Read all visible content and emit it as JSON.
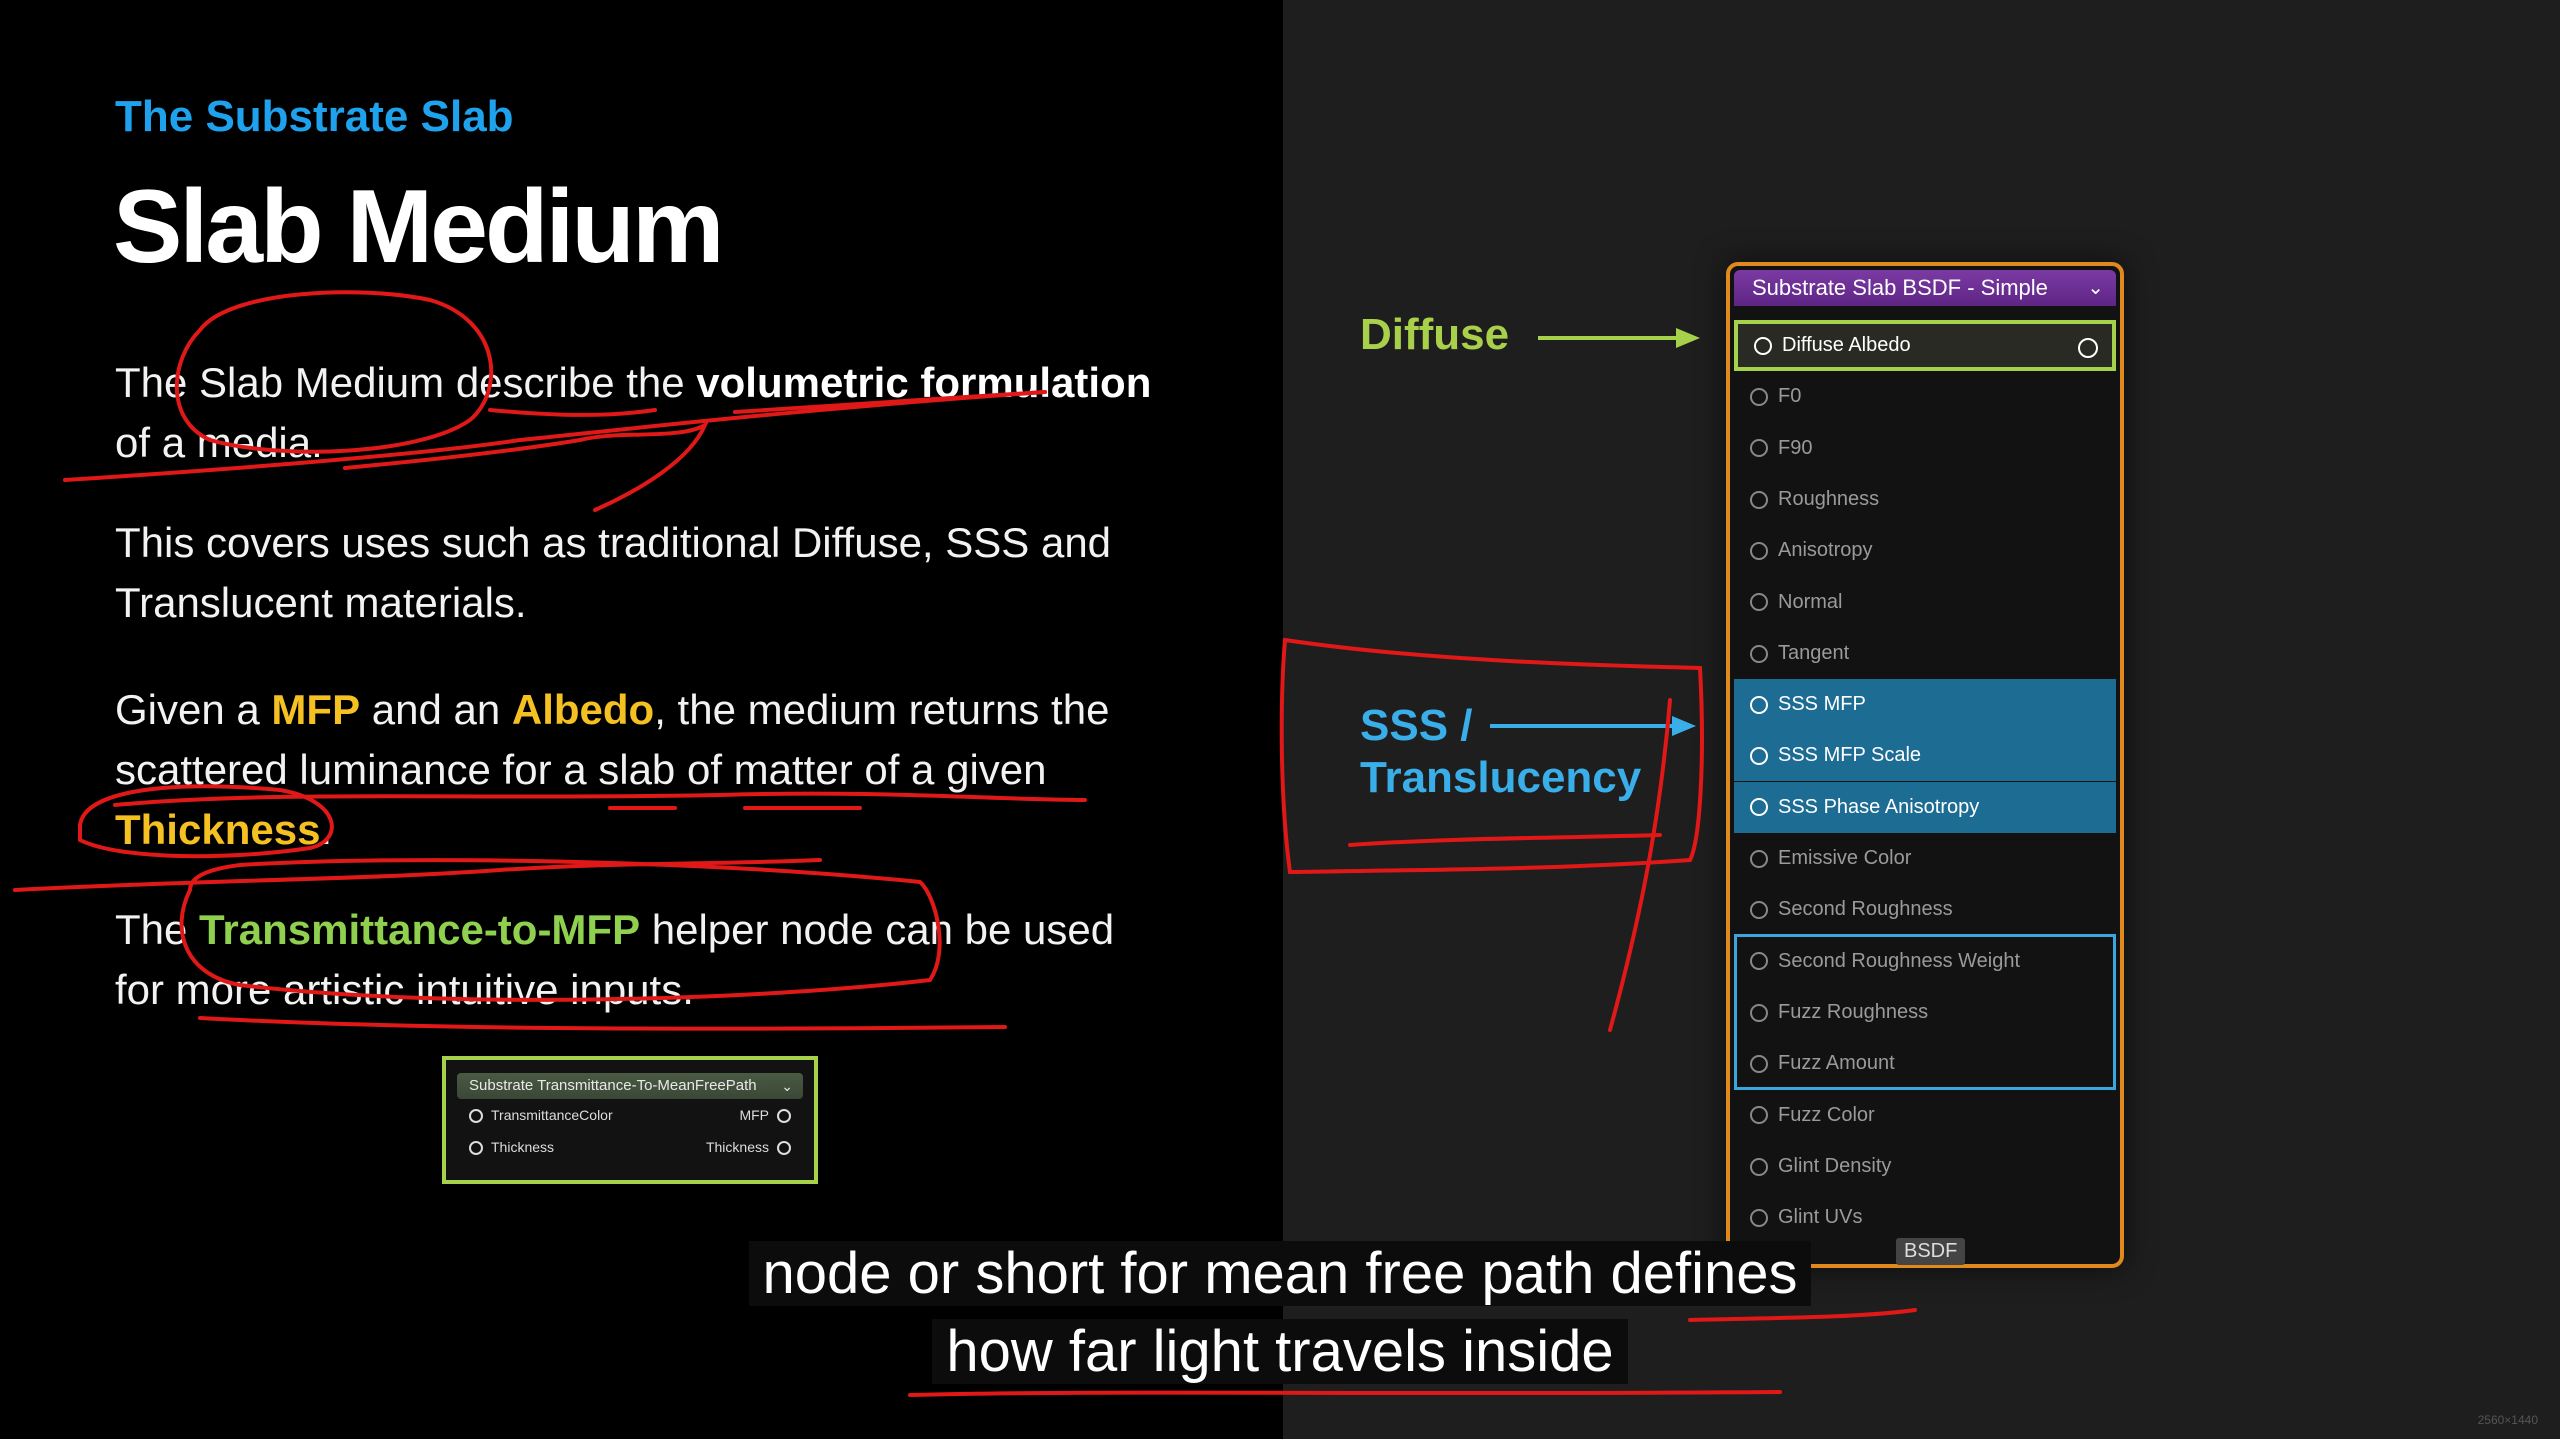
{
  "slide": {
    "eyebrow": "The Substrate Slab",
    "title": "Slab Medium",
    "p1": {
      "t1": "The Slab Medium describe the ",
      "b1": "volumetric formulation",
      "t2": " of a media."
    },
    "p2": "This covers uses such as traditional Diffuse, SSS and Translucent materials.",
    "p3": {
      "t1": "Given a ",
      "mfp": "MFP",
      "t2": " and an ",
      "albedo": "Albedo",
      "t3": ", the medium returns the scattered luminance for a slab of matter of a given ",
      "thickness": "Thickness",
      "t4": "."
    },
    "p4": {
      "t1": "The ",
      "node": "Transmittance-to-MFP",
      "t2": " helper node can be used for more artistic intuitive inputs."
    },
    "helper_node": {
      "title": "Substrate Transmittance-To-MeanFreePath",
      "in1": "TransmittanceColor",
      "out1": "MFP",
      "in2": "Thickness",
      "out2": "Thickness"
    }
  },
  "labels": {
    "diffuse": "Diffuse",
    "sss_line1": "SSS /",
    "sss_line2": "Translucency"
  },
  "bsdf_node": {
    "title": "Substrate Slab BSDF - Simple",
    "pins": [
      "Diffuse Albedo",
      "F0",
      "F90",
      "Roughness",
      "Anisotropy",
      "Normal",
      "Tangent",
      "SSS MFP",
      "SSS MFP Scale",
      "SSS Phase Anisotropy",
      "Emissive Color",
      "Second Roughness",
      "Second Roughness Weight",
      "Fuzz Roughness",
      "Fuzz Amount",
      "Fuzz Color",
      "Glint Density",
      "Glint UVs"
    ],
    "footer": "BSDF"
  },
  "captions": {
    "line1": "node or short for mean free path defines",
    "line2": "how far light travels inside"
  },
  "resolution_label": "2560×1440",
  "colors": {
    "eyebrow": "#1fa2ee",
    "highlight_yellow": "#f5c022",
    "highlight_green": "#8fd14f",
    "node_border": "#e08a1e",
    "sss_highlight": "#1d6c94",
    "annotation_red": "#e01818"
  }
}
